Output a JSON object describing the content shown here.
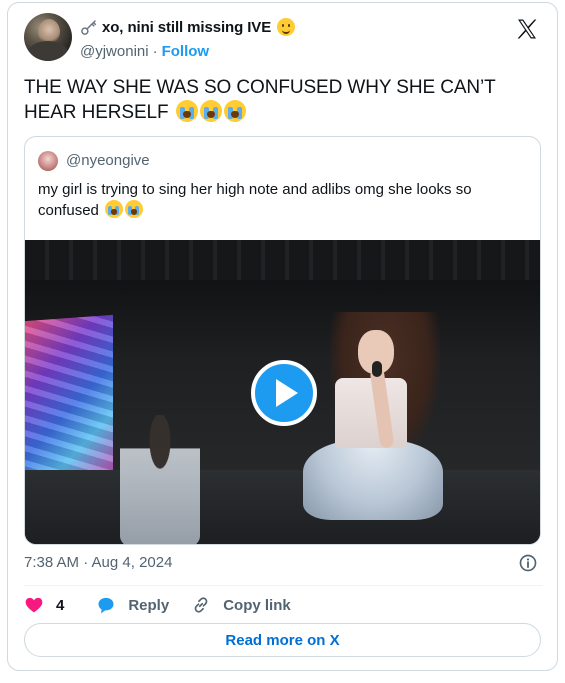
{
  "author": {
    "display_name": "xo, nini still missing IVE",
    "handle": "@yjwonini",
    "separator": "·",
    "follow_label": "Follow",
    "name_prefix_icon": "key-icon",
    "name_suffix_icon": "slightly-smiling-face-icon"
  },
  "tweet": {
    "text": "THE WAY SHE WAS SO CONFUSED WHY SHE CAN’T HEAR HERSELF",
    "emoji": [
      "loudly-crying-face",
      "loudly-crying-face",
      "loudly-crying-face"
    ],
    "timestamp": "7:38 AM · Aug 4, 2024"
  },
  "quoted_tweet": {
    "handle": "@nyeongive",
    "text": "my girl is trying to sing her high note and adlibs omg she looks so confused",
    "emoji": [
      "loudly-crying-face",
      "loudly-crying-face"
    ],
    "media": {
      "type": "video",
      "play_icon": "play-icon"
    }
  },
  "actions": {
    "like_count": "4",
    "reply_label": "Reply",
    "copy_link_label": "Copy link"
  },
  "read_more_label": "Read more on X",
  "colors": {
    "accent": "#1d9bf0",
    "link": "#006fd6",
    "like": "#f91880",
    "muted": "#536471",
    "border": "#cfd9de"
  }
}
